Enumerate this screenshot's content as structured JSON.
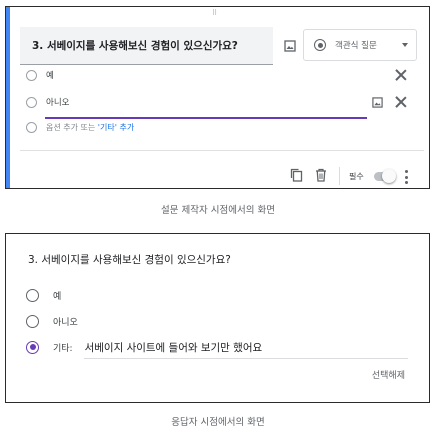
{
  "editor": {
    "question_title": "3. 서베이지를 사용해보신 경험이 있으신가요?",
    "drag_handle": "⠿",
    "question_type": "객관식 질문",
    "options": [
      {
        "label": "예"
      },
      {
        "label": "아니오"
      }
    ],
    "add_option_text": "옵션 추가 또는 ",
    "add_other_text": "'기타' 추가",
    "required_label": "필수"
  },
  "editor_caption": "설문 제작자 시점에서의 화면",
  "respondent": {
    "question_title": "3. 서베이지를 사용해보신 경험이 있으신가요?",
    "options": [
      {
        "label": "예",
        "selected": false
      },
      {
        "label": "아니오",
        "selected": false
      }
    ],
    "other_label": "기타:",
    "other_value": "서베이지 사이트에 들어와 보기만 했어요",
    "other_selected": true,
    "clear_selection": "선택해제"
  },
  "respondent_caption": "응답자 시점에서의 화면",
  "colors": {
    "accent_blue": "#4285f4",
    "accent_purple": "#673ab7",
    "link_blue": "#1a73e8"
  }
}
